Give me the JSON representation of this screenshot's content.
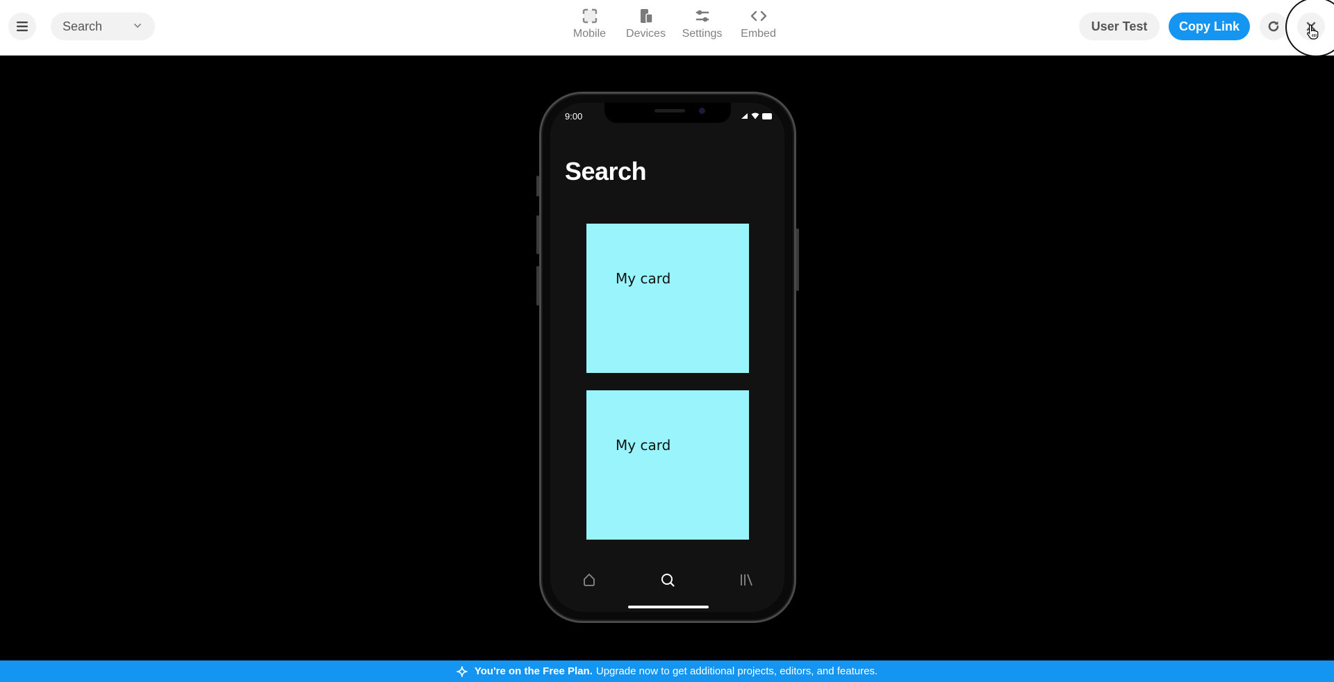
{
  "toolbar": {
    "menu_icon": "hamburger-icon",
    "page_select": {
      "value": "Search",
      "icon": "chevron-down-icon"
    },
    "tools": [
      {
        "label": "Mobile",
        "icon": "frame-corners-icon"
      },
      {
        "label": "Devices",
        "icon": "devices-icon"
      },
      {
        "label": "Settings",
        "icon": "sliders-icon"
      },
      {
        "label": "Embed",
        "icon": "code-brackets-icon"
      }
    ],
    "user_test_label": "User Test",
    "copy_link_label": "Copy Link",
    "refresh_icon": "refresh-icon",
    "close_icon": "close-icon",
    "accent_color": "#1595f2"
  },
  "phone": {
    "status_time": "9:00",
    "status_icons": [
      "cellular-icon",
      "wifi-icon",
      "battery-icon"
    ],
    "screen_title": "Search",
    "cards": [
      {
        "label": "My card",
        "color": "#99f5fb"
      },
      {
        "label": "My card",
        "color": "#99f5fb"
      }
    ],
    "tab_bar": [
      {
        "name": "home",
        "icon": "home-icon",
        "active": false
      },
      {
        "name": "search",
        "icon": "search-icon",
        "active": true
      },
      {
        "name": "library",
        "icon": "library-icon",
        "active": false
      }
    ]
  },
  "banner": {
    "bold": "You're on the Free Plan.",
    "text": "Upgrade now to get additional projects, editors, and features.",
    "icon": "sparkle-icon"
  }
}
